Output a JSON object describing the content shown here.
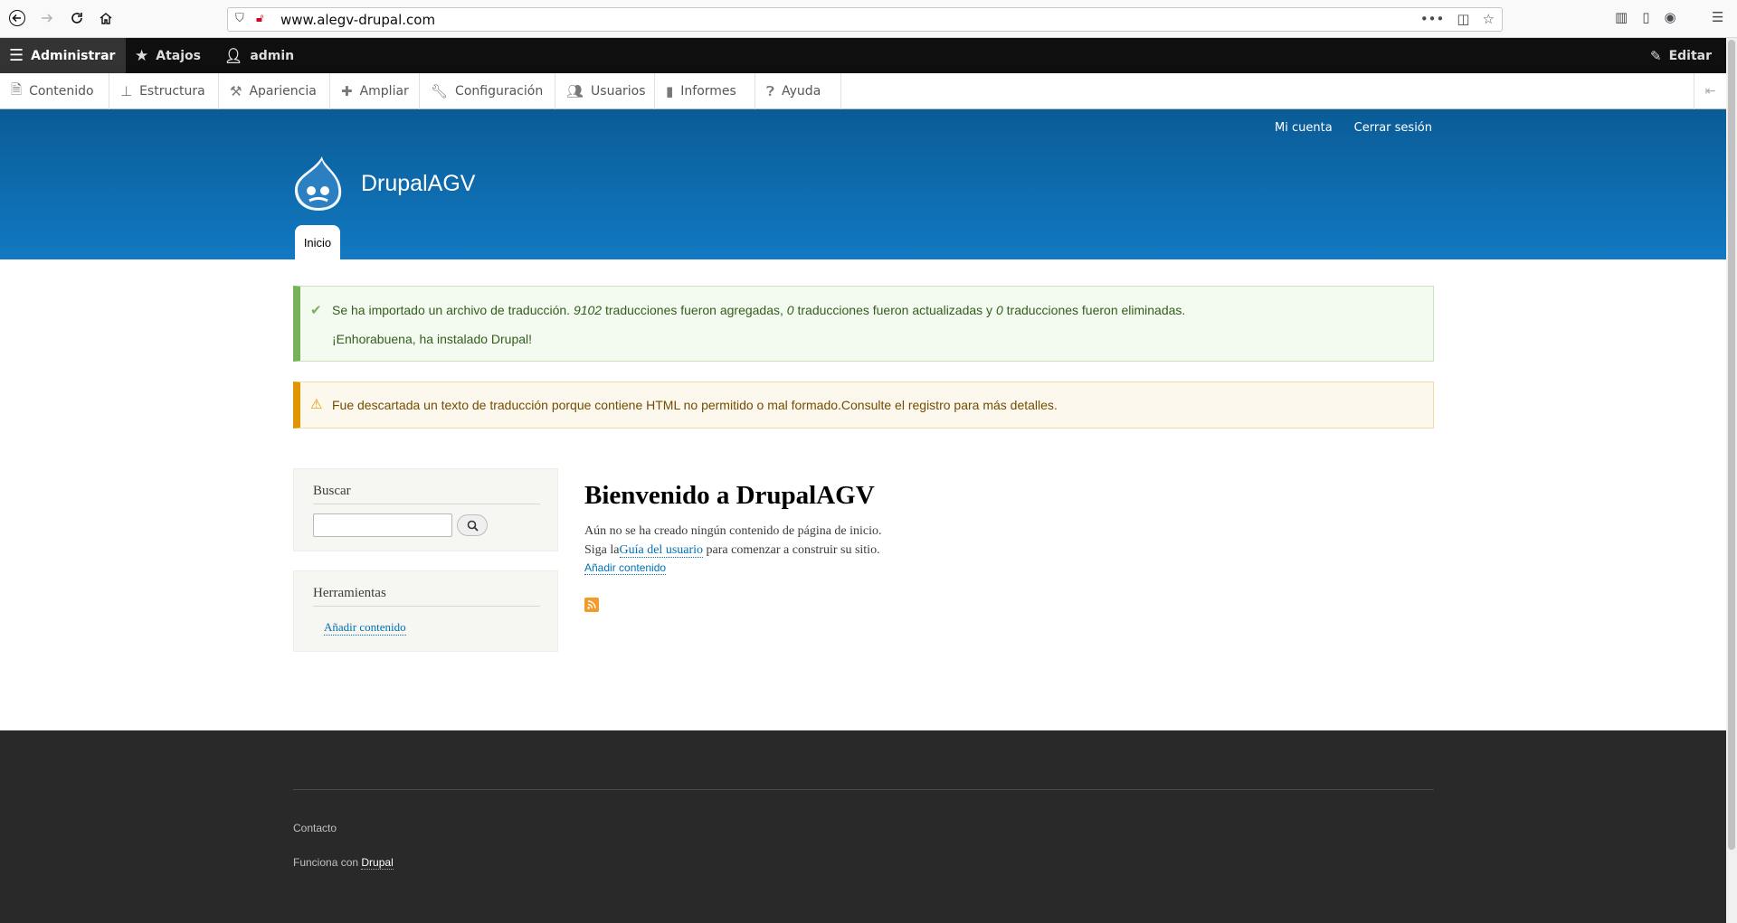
{
  "browser": {
    "url": "www.alegv-drupal.com"
  },
  "admin_toolbar": {
    "manage": "Administrar",
    "shortcuts": "Atajos",
    "user": "admin",
    "edit": "Editar"
  },
  "admin_tray": [
    {
      "label": "Contenido",
      "icon": "file-icon"
    },
    {
      "label": "Estructura",
      "icon": "sitemap-icon"
    },
    {
      "label": "Apariencia",
      "icon": "paintbrush-icon"
    },
    {
      "label": "Ampliar",
      "icon": "puzzle-icon"
    },
    {
      "label": "Configuración",
      "icon": "wrench-icon"
    },
    {
      "label": "Usuarios",
      "icon": "people-icon"
    },
    {
      "label": "Informes",
      "icon": "bar-chart-icon"
    },
    {
      "label": "Ayuda",
      "icon": "help-icon"
    }
  ],
  "header": {
    "site_name": "DrupalAGV",
    "my_account": "Mi cuenta",
    "logout": "Cerrar sesión",
    "main_tab": "Inicio"
  },
  "messages": {
    "status_pre": "Se ha importado un archivo de traducción.",
    "added_count": "9102",
    "added_text": "traducciones fueron agregadas,",
    "updated_count": "0",
    "updated_text": "traducciones fueron actualizadas y",
    "deleted_count": "0",
    "deleted_text": "traducciones fueron eliminadas.",
    "status_line2": "¡Enhorabuena, ha instalado Drupal!",
    "warning": "Fue descartada un texto de traducción porque contiene HTML no permitido o mal formado.Consulte el registro para más detalles."
  },
  "sidebar": {
    "search_title": "Buscar",
    "search_value": "",
    "tools_title": "Herramientas",
    "tools_link": "Añadir contenido"
  },
  "main": {
    "title": "Bienvenido a DrupalAGV",
    "line1": "Aún no se ha creado ningún contenido de página de inicio.",
    "line2_pre": "Siga la",
    "line2_link": "Guía del usuario",
    "line2_post": " para comenzar a construir su sitio.",
    "add_link": "Añadir contenido"
  },
  "footer": {
    "contact": "Contacto",
    "powered_pre": "Funciona con ",
    "powered_link": "Drupal"
  }
}
